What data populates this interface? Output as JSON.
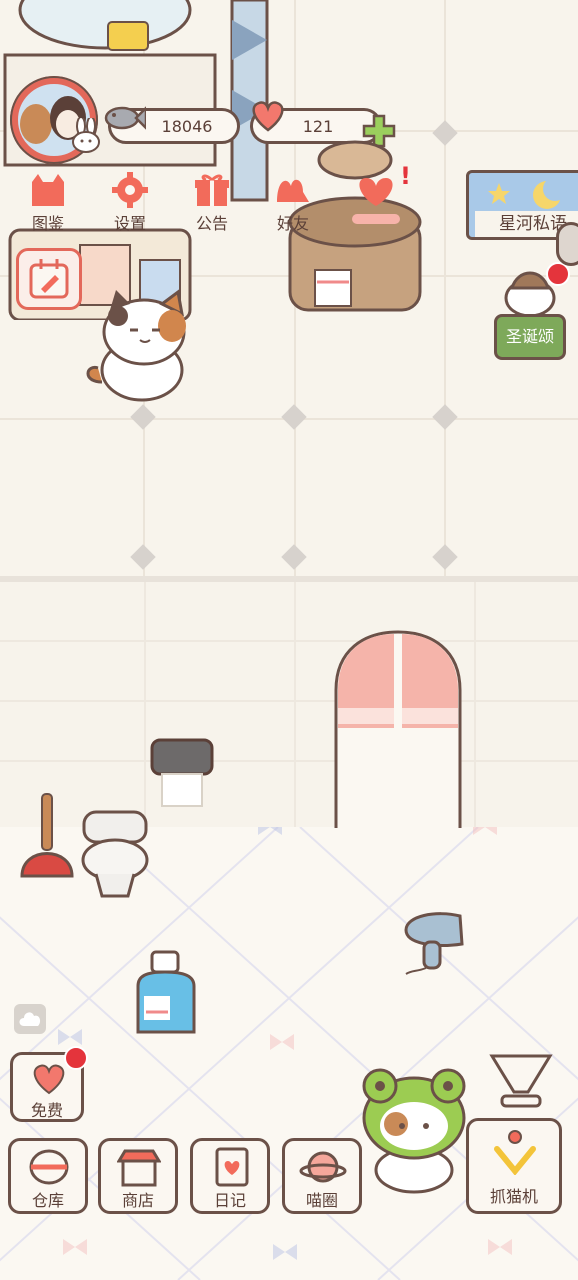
{
  "currency": {
    "fish": "18046",
    "hearts": "121"
  },
  "top_menu": [
    {
      "label": "图鉴",
      "icon": "cat-book-icon"
    },
    {
      "label": "设置",
      "icon": "gear-icon"
    },
    {
      "label": "公告",
      "icon": "gift-icon"
    },
    {
      "label": "好友",
      "icon": "friends-icon"
    },
    {
      "label": "",
      "icon": "heart-mail-icon"
    }
  ],
  "event_banner": {
    "label": "星河私语"
  },
  "christmas_event": {
    "label": "圣诞颂"
  },
  "free_button": {
    "label": "免费"
  },
  "bottom_nav": [
    {
      "label": "仓库",
      "icon": "storage-icon"
    },
    {
      "label": "商店",
      "icon": "shop-icon"
    },
    {
      "label": "日记",
      "icon": "diary-icon"
    },
    {
      "label": "喵圈",
      "icon": "planet-cat-icon"
    }
  ],
  "claw_machine": {
    "label": "抓猫机"
  },
  "colors": {
    "accent": "#f26b5b",
    "border": "#6b5148",
    "badge": "#e4343c",
    "green": "#7ea95a"
  }
}
